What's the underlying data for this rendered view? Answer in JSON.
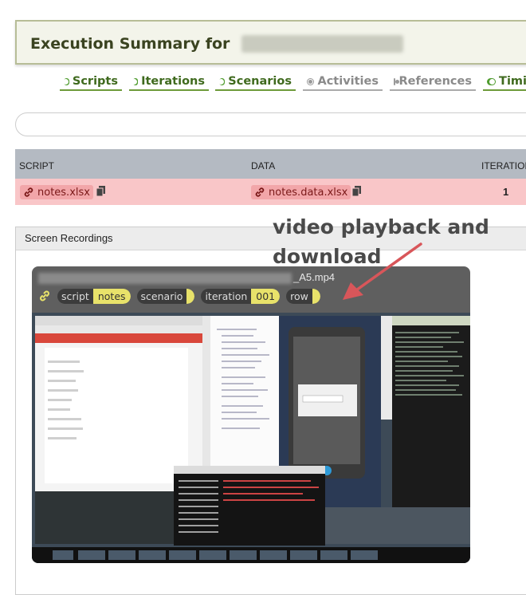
{
  "header": {
    "title": "Execution Summary for",
    "title_redacted": "20211010_083629"
  },
  "tabs": [
    {
      "label": "Scripts",
      "enabled": true
    },
    {
      "label": "Iterations",
      "enabled": true
    },
    {
      "label": "Scenarios",
      "enabled": true
    },
    {
      "label": "Activities",
      "enabled": false
    },
    {
      "label": "References",
      "enabled": false
    },
    {
      "label": "Timi",
      "enabled": true
    }
  ],
  "table": {
    "headers": [
      "SCRIPT",
      "DATA",
      "ITERATION"
    ],
    "rows": [
      {
        "script": "notes.xlsx",
        "data": "notes.data.xlsx",
        "iteration": "1"
      }
    ]
  },
  "recordings": {
    "panel_title": "Screen Recordings",
    "video": {
      "filename_suffix": "_A5.mp4",
      "tags": [
        {
          "key": "script",
          "value": "notes"
        },
        {
          "key": "scenario",
          "value": ""
        },
        {
          "key": "iteration",
          "value": "001"
        },
        {
          "key": "row",
          "value": ""
        }
      ]
    }
  },
  "annotation": {
    "line1": "video playback and",
    "line2": "download"
  },
  "colors": {
    "accent_green": "#4f9c2e",
    "row_fail": "#f9c6c8",
    "tag_yellow": "#e8e26a"
  }
}
